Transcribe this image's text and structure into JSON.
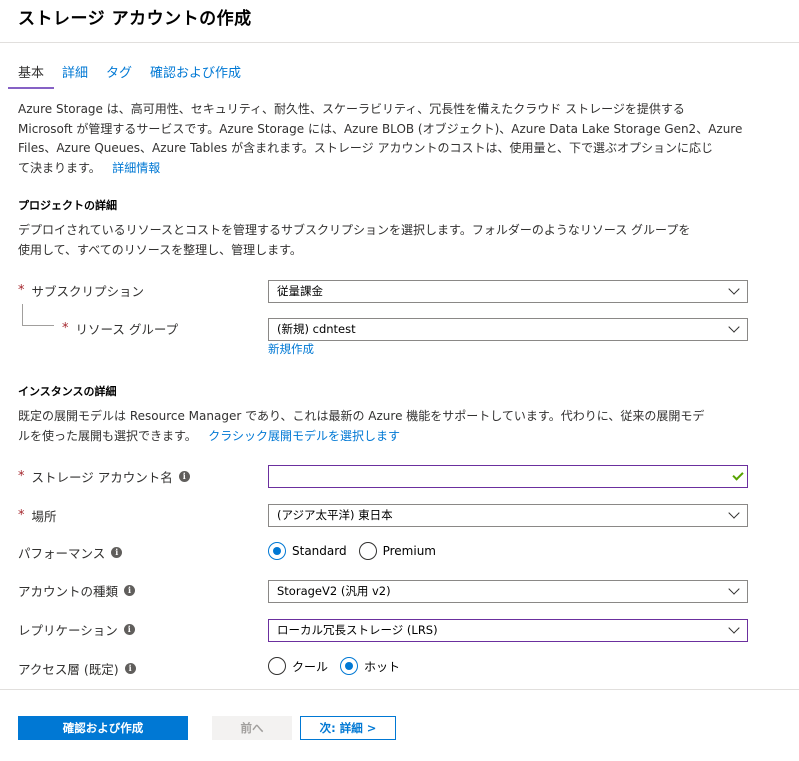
{
  "title": "ストレージ アカウントの作成",
  "tabs": [
    {
      "label": "基本",
      "active": true
    },
    {
      "label": "詳細",
      "active": false
    },
    {
      "label": "タグ",
      "active": false
    },
    {
      "label": "確認および作成",
      "active": false
    }
  ],
  "intro": {
    "line1": "Azure Storage は、高可用性、セキュリティ、耐久性、スケーラビリティ、冗長性を備えたクラウド ストレージを提供する",
    "line2": "Microsoft が管理するサービスです。Azure Storage には、Azure BLOB (オブジェクト)、Azure Data Lake Storage Gen2、Azure",
    "line3": "Files、Azure Queues、Azure Tables が含まれます。ストレージ アカウントのコストは、使用量と、下で選ぶオプションに応じ",
    "line4": "て決まります。",
    "link": "詳細情報"
  },
  "project": {
    "heading": "プロジェクトの詳細",
    "desc_line1": "デプロイされているリソースとコストを管理するサブスクリプションを選択します。フォルダーのようなリソース グループを",
    "desc_line2": "使用して、すべてのリソースを整理し、管理します。",
    "subscription_label": "サブスクリプション",
    "subscription_value": "従量課金",
    "resource_group_label": "リソース グループ",
    "resource_group_value": "(新規) cdntest",
    "create_new_link": "新規作成"
  },
  "instance": {
    "heading": "インスタンスの詳細",
    "desc_line1": "既定の展開モデルは Resource Manager であり、これは最新の Azure 機能をサポートしています。代わりに、従来の展開モデ",
    "desc_line2": "ルを使った展開も選択できます。",
    "classic_link": "クラシック展開モデルを選択します",
    "account_name_label": "ストレージ アカウント名",
    "account_name_value": "",
    "location_label": "場所",
    "location_value": "(アジア太平洋) 東日本",
    "performance_label": "パフォーマンス",
    "performance_options": [
      "Standard",
      "Premium"
    ],
    "performance_selected": "Standard",
    "account_kind_label": "アカウントの種類",
    "account_kind_value": "StorageV2 (汎用 v2)",
    "replication_label": "レプリケーション",
    "replication_value": "ローカル冗長ストレージ (LRS)",
    "access_tier_label": "アクセス層 (既定)",
    "access_tier_options": [
      "クール",
      "ホット"
    ],
    "access_tier_selected": "ホット"
  },
  "footer": {
    "review_button": "確認および作成",
    "prev_button": "前へ",
    "next_button": "次: 詳細 >"
  },
  "icons": {
    "required": "*",
    "info": "i"
  },
  "colors": {
    "accent": "#0078d4",
    "focus_border": "#6b2f9e",
    "tab_underline": "#8661c5",
    "required": "#a4262c",
    "valid": "#57a300"
  }
}
